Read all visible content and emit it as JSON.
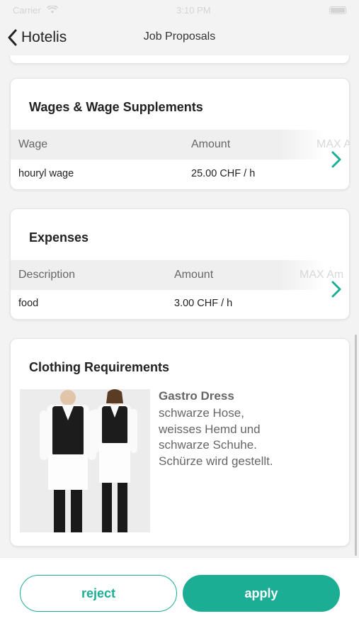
{
  "status_bar": {
    "carrier": "Carrier",
    "time": "3:10 PM"
  },
  "nav": {
    "back_label": "Hotelis",
    "title": "Job Proposals"
  },
  "wages": {
    "title": "Wages & Wage Supplements",
    "columns": [
      "Wage",
      "Amount",
      "MAX A"
    ],
    "rows": [
      {
        "label": "houryl wage",
        "amount": "25.00 CHF / h"
      }
    ]
  },
  "expenses": {
    "title": "Expenses",
    "columns": [
      "Description",
      "Amount",
      "MAX Am"
    ],
    "rows": [
      {
        "label": "food",
        "amount": "3.00 CHF / h"
      }
    ]
  },
  "clothing": {
    "title": "Clothing Requirements",
    "name": "Gastro Dress",
    "description": "schwarze Hose,\nweisses Hemd und\nschwarze Schuhe.\nSchürze wird gestellt."
  },
  "actions": {
    "reject_label": "reject",
    "apply_label": "apply"
  },
  "colors": {
    "accent": "#1cae94",
    "background": "#f3f3f3"
  },
  "icons": [
    "back-chevron-icon",
    "chevron-right-icon",
    "wifi-icon",
    "battery-icon"
  ]
}
